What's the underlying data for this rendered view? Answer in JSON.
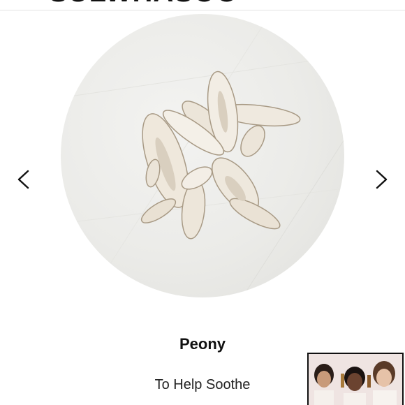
{
  "header": {
    "logo_text": "SULWHASOO"
  },
  "carousel": {
    "prev_label": "Previous",
    "next_label": "Next",
    "ingredient": {
      "name": "Peony",
      "benefit": "To Help Soothe",
      "image_icon": "dried-peony-root-slices"
    }
  },
  "video_thumbnail": {
    "icon": "models-video-thumbnail"
  },
  "colors": {
    "text": "#111111",
    "divider": "#e2e2e2",
    "circle_bg": "#ebebe8"
  }
}
